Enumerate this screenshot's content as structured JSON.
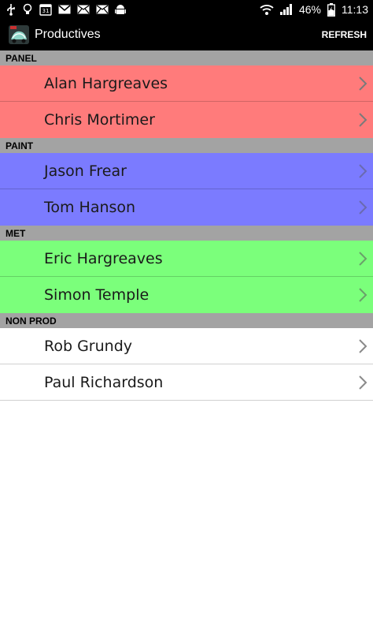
{
  "status_bar": {
    "left_icons": [
      "usb-icon",
      "bulb-icon",
      "calendar-icon",
      "gmail-icon",
      "email-icon",
      "email-icon",
      "android-icon"
    ],
    "calendar_day": "31",
    "battery_percent": "46%",
    "time": "11:13"
  },
  "action_bar": {
    "title": "Productives",
    "refresh_label": "REFRESH"
  },
  "colors": {
    "panel": "#ff7b7b",
    "paint": "#7b7bff",
    "met": "#7bff7b",
    "non_prod": "#ffffff",
    "header_bg": "#a3a3a3"
  },
  "sections": [
    {
      "header": "PANEL",
      "items": [
        "Alan Hargreaves",
        "Chris Mortimer"
      ]
    },
    {
      "header": "PAINT",
      "items": [
        "Jason Frear",
        "Tom Hanson"
      ]
    },
    {
      "header": "MET",
      "items": [
        "Eric Hargreaves",
        "Simon Temple"
      ]
    },
    {
      "header": "NON PROD",
      "items": [
        "Rob Grundy",
        "Paul Richardson"
      ]
    }
  ]
}
